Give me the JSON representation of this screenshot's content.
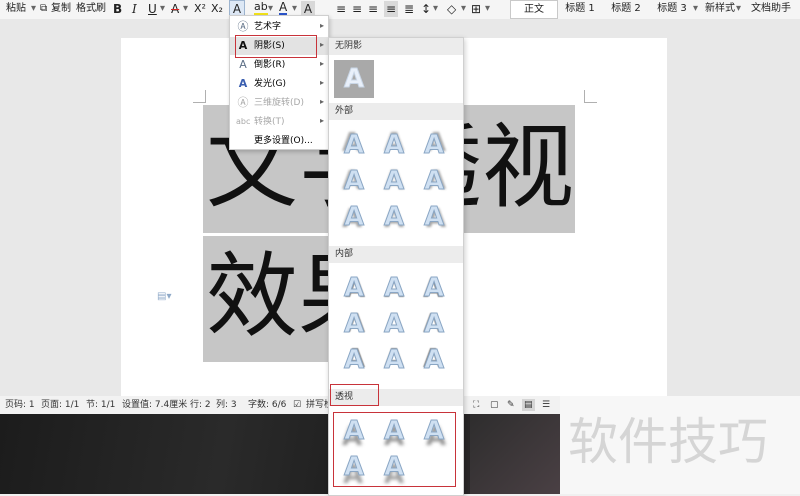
{
  "toolbar": {
    "paste": "粘贴",
    "copy": "复制",
    "format_painter": "格式刷",
    "bold": "B",
    "italic": "I",
    "underline": "U",
    "strike": "A",
    "superscript": "X²",
    "subscript": "X₂",
    "text_effect": "A",
    "highlight": "ab",
    "font_color": "A",
    "char_shading": "A",
    "styles": [
      "正文",
      "标题 1",
      "标题 2",
      "标题 3"
    ],
    "new_style": "新样式",
    "doc_assistant": "文档助手"
  },
  "document": {
    "line1": "文字透视",
    "line2": "效果"
  },
  "effect_menu": {
    "items": [
      {
        "icon": "art-text-icon",
        "label": "艺术字",
        "has_arrow": true,
        "enabled": true
      },
      {
        "icon": "shadow-icon",
        "label": "阴影(S)",
        "has_arrow": true,
        "enabled": true
      },
      {
        "icon": "reflection-icon",
        "label": "倒影(R)",
        "has_arrow": true,
        "enabled": true
      },
      {
        "icon": "glow-icon",
        "label": "发光(G)",
        "has_arrow": true,
        "enabled": true
      },
      {
        "icon": "3d-rotation-icon",
        "label": "三维旋转(D)",
        "has_arrow": true,
        "enabled": false
      },
      {
        "icon": "transform-icon",
        "label": "转换(T)",
        "has_arrow": true,
        "enabled": false
      },
      {
        "icon": "",
        "label": "更多设置(O)...",
        "has_arrow": false,
        "enabled": true
      }
    ]
  },
  "shadow_submenu": {
    "no_shadow": "无阴影",
    "outer": "外部",
    "inner": "内部",
    "perspective": "透视",
    "swatch_letter": "A"
  },
  "statusbar": {
    "page_no": "页码: 1",
    "pages": "页面: 1/1",
    "section": "节: 1/1",
    "setting": "设置值: 7.4厘米",
    "row": "行: 2",
    "col": "列: 3",
    "words": "字数: 6/6",
    "spell": "拼写检"
  },
  "watermark": "软件技巧",
  "colors": {
    "highlight_red": "#c8333a",
    "selection": "#c6c6c6",
    "swatch_fill": "#cfe0f2"
  }
}
